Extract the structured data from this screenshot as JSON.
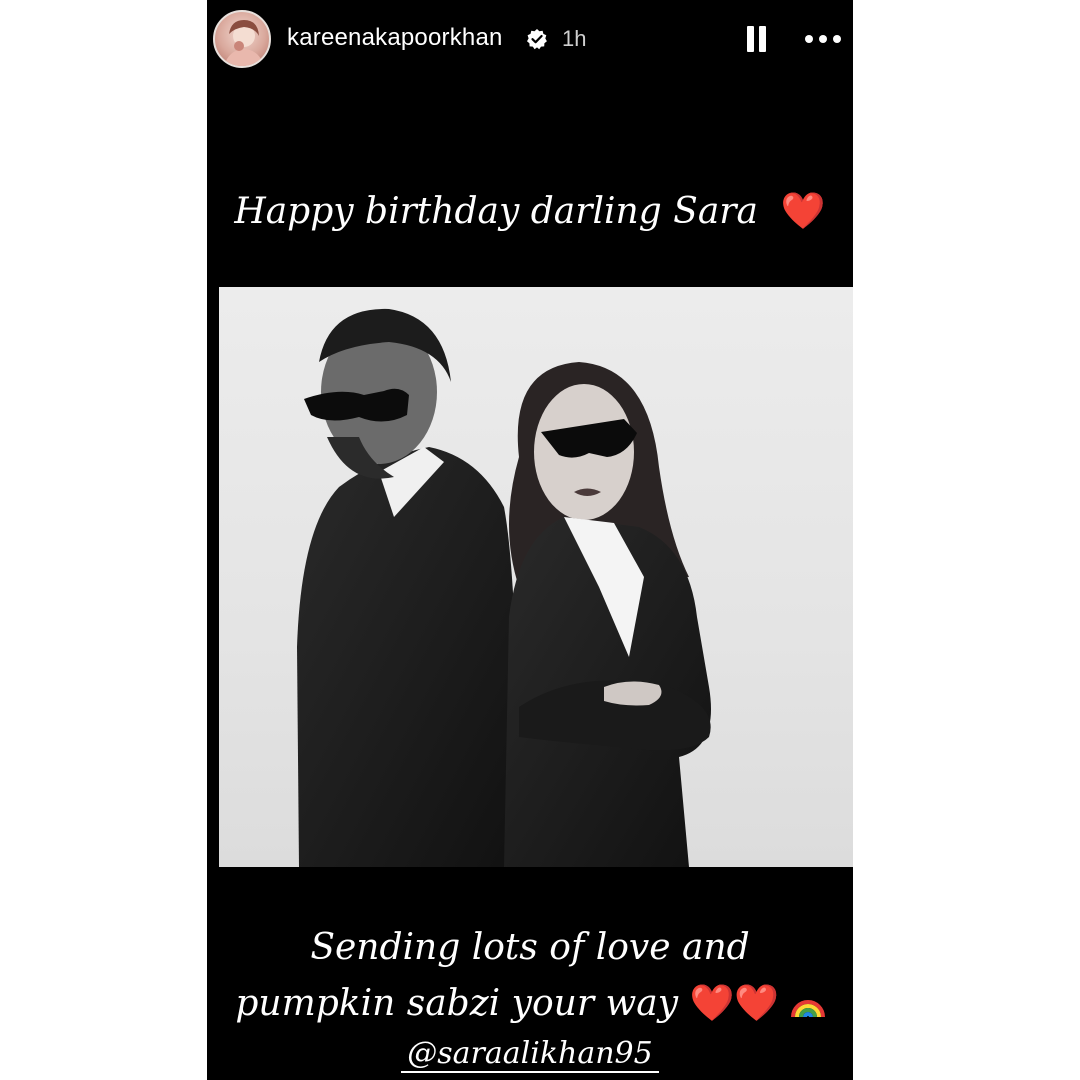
{
  "header": {
    "username": "kareenakapoorkhan",
    "time": "1h"
  },
  "captions": {
    "top": "Happy birthday darling Sara",
    "top_emoji": "❤️",
    "bottom_line1": "Sending lots of love and",
    "bottom_line2": "pumpkin sabzi your way",
    "bottom_emoji": "❤️❤️",
    "mention": "@saraalikhan95"
  },
  "icons": {
    "verified": "verified-badge-icon",
    "pause": "pause-icon",
    "more": "more-options-icon",
    "rainbow": "rainbow-emoji"
  },
  "colors": {
    "background": "#000000",
    "heart": "#e0141e",
    "photo_bg": "#e8e8e8"
  }
}
